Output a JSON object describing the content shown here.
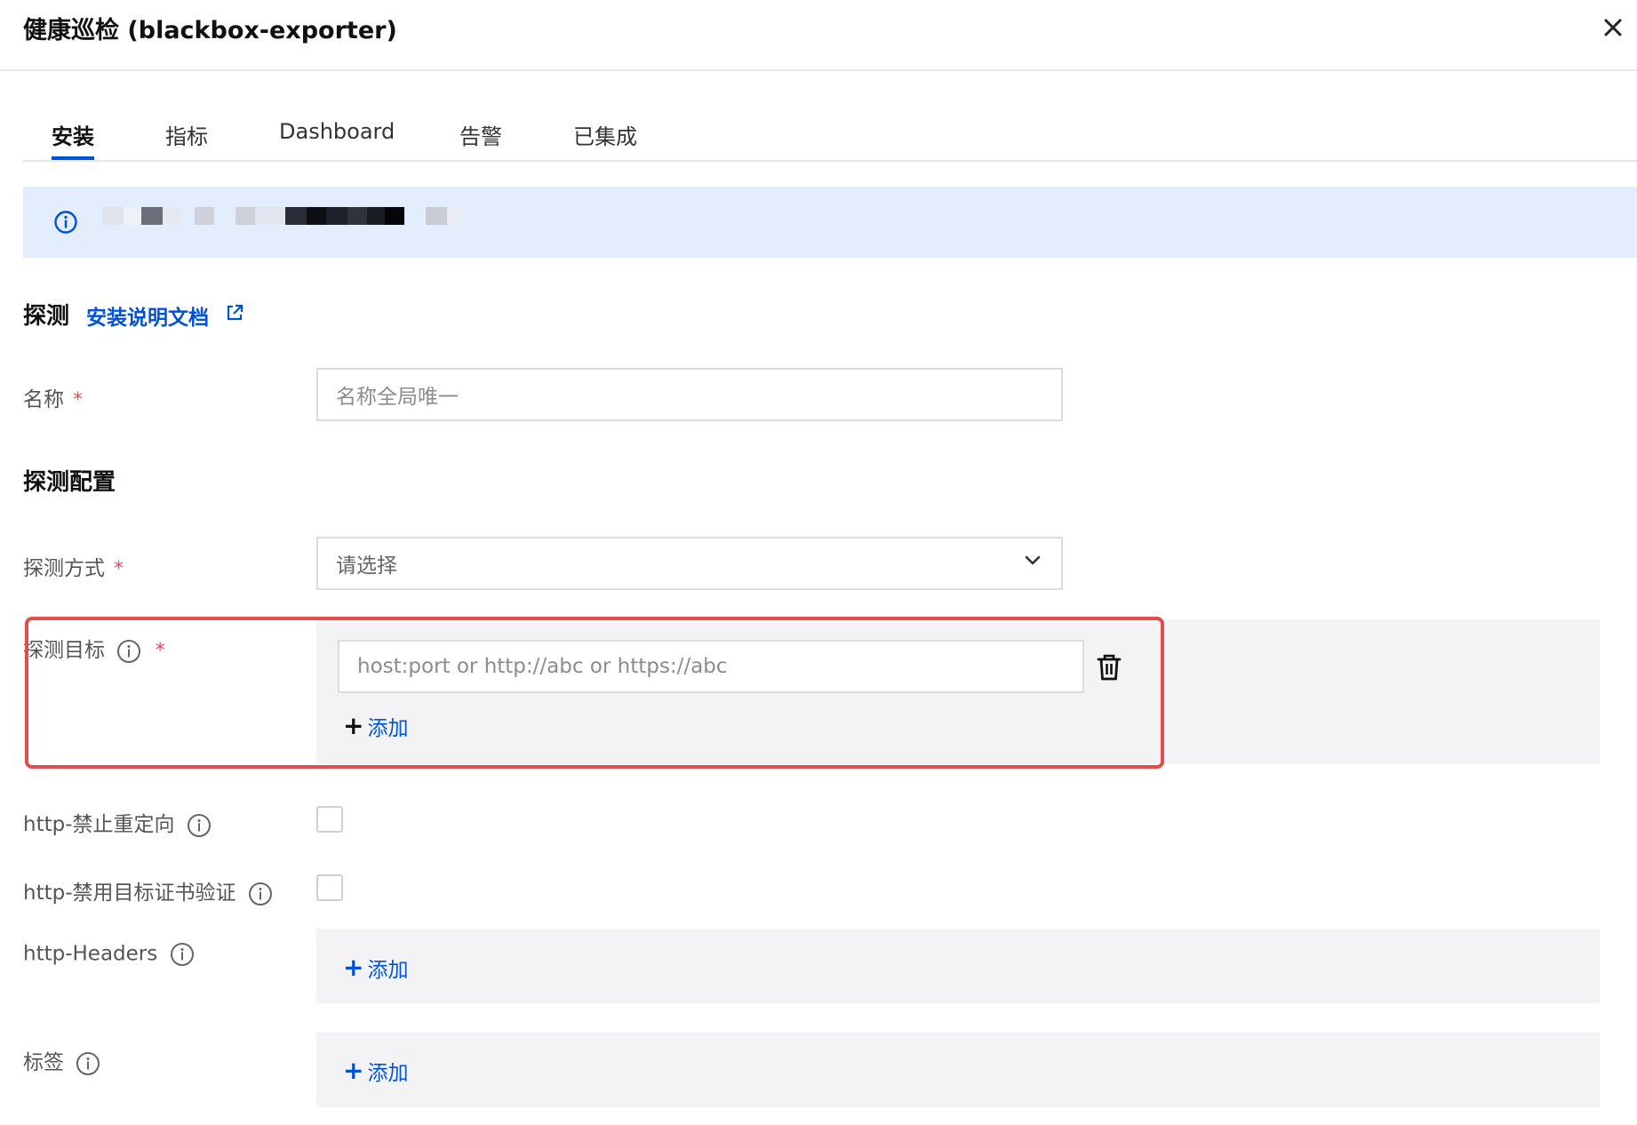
{
  "header": {
    "title": "健康巡检 (blackbox-exporter)"
  },
  "tabs": [
    {
      "label": "安装",
      "active": true
    },
    {
      "label": "指标",
      "active": false
    },
    {
      "label": "Dashboard",
      "active": false
    },
    {
      "label": "告警",
      "active": false
    },
    {
      "label": "已集成",
      "active": false
    }
  ],
  "section_probe": {
    "title": "探测",
    "doc_link": "安装说明文档"
  },
  "name_field": {
    "label": "名称",
    "required": "*",
    "placeholder": "名称全局唯一"
  },
  "section_config": {
    "title": "探测配置"
  },
  "method_field": {
    "label": "探测方式",
    "required": "*",
    "value": "请选择"
  },
  "target_field": {
    "label": "探测目标",
    "required": "*",
    "placeholder": "host:port or http://abc or https://abc",
    "add_label": "添加"
  },
  "no_redirect": {
    "label": "http-禁止重定向",
    "checked": false
  },
  "skip_verify": {
    "label": "http-禁用目标证书验证",
    "checked": false
  },
  "headers": {
    "label": "http-Headers",
    "add_label": "添加"
  },
  "tags": {
    "label": "标签",
    "add_label": "添加"
  },
  "colors": {
    "accent": "#0052d9",
    "banner_bg": "#e4edfc",
    "required": "#e34d59",
    "highlight": "#e34d4d",
    "group_bg": "#f3f3f6"
  },
  "icons": [
    "close-icon",
    "info-icon",
    "external-link-icon",
    "chevron-down-icon",
    "trash-icon",
    "plus-icon"
  ]
}
